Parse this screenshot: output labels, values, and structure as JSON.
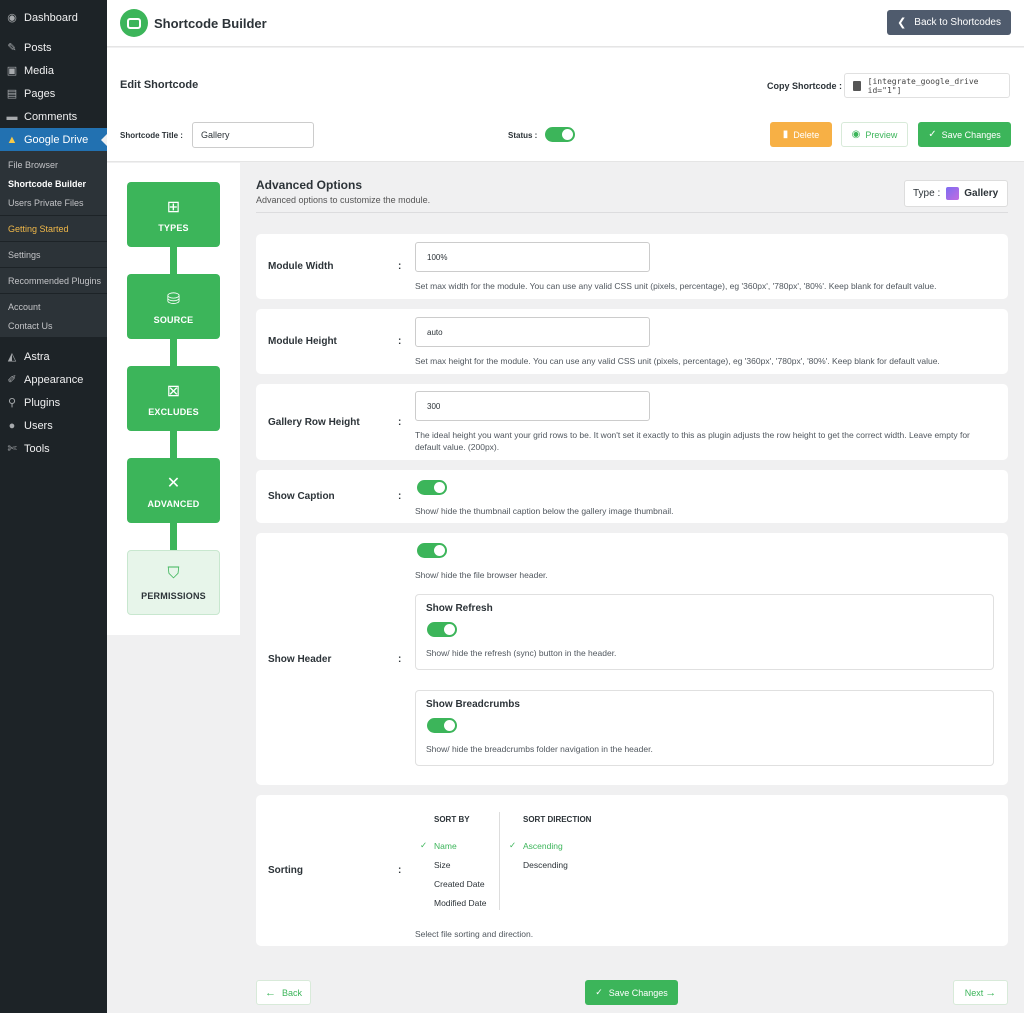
{
  "wp_menu": {
    "items_top": [
      {
        "label": "Dashboard",
        "icon": "dashboard-icon",
        "glyph": "◉"
      },
      {
        "label": "Posts",
        "icon": "pin-icon",
        "glyph": "✎"
      },
      {
        "label": "Media",
        "icon": "media-icon",
        "glyph": "▣"
      },
      {
        "label": "Pages",
        "icon": "pages-icon",
        "glyph": "▤"
      },
      {
        "label": "Comments",
        "icon": "comments-icon",
        "glyph": "▬"
      }
    ],
    "active_item": {
      "label": "Google Drive",
      "icon": "google-drive-icon",
      "glyph": "▲"
    },
    "submenu": [
      "File Browser",
      "Shortcode Builder",
      "Users Private Files",
      "Getting Started",
      "Settings",
      "Recommended Plugins",
      "Account",
      "Contact Us"
    ],
    "items_bottom": [
      {
        "label": "Astra",
        "icon": "astra-icon",
        "glyph": "◭"
      },
      {
        "label": "Appearance",
        "icon": "appearance-icon",
        "glyph": "✐"
      },
      {
        "label": "Plugins",
        "icon": "plugins-icon",
        "glyph": "⚲"
      },
      {
        "label": "Users",
        "icon": "users-icon",
        "glyph": "●"
      },
      {
        "label": "Tools",
        "icon": "tools-icon",
        "glyph": "✄"
      }
    ]
  },
  "header": {
    "brand": "Shortcode Builder",
    "back_label": "Back to Shortcodes"
  },
  "editbar": {
    "title": "Edit Shortcode",
    "copy_label": "Copy Shortcode :",
    "shortcode": "[integrate_google_drive id=\"1\"]",
    "title_label": "Shortcode Title :",
    "title_value": "Gallery",
    "status_label": "Status :",
    "delete_label": "Delete",
    "preview_label": "Preview",
    "save_label": "Save Changes"
  },
  "steps": [
    "TYPES",
    "SOURCE",
    "EXCLUDES",
    "ADVANCED",
    "PERMISSIONS"
  ],
  "section": {
    "title": "Advanced Options",
    "subtitle": "Advanced options to customize the module.",
    "type_label": "Type :",
    "type_value": "Gallery"
  },
  "options": {
    "module_width": {
      "label": "Module Width",
      "value": "100%",
      "desc": "Set max width for the module. You can use any valid CSS unit (pixels, percentage), eg '360px', '780px', '80%'. Keep blank for default value."
    },
    "module_height": {
      "label": "Module Height",
      "value": "auto",
      "desc": "Set max height for the module. You can use any valid CSS unit (pixels, percentage), eg '360px', '780px', '80%'. Keep blank for default value."
    },
    "row_height": {
      "label": "Gallery Row Height",
      "value": "300",
      "desc": "The ideal height you want your grid rows to be. It won't set it exactly to this as plugin adjusts the row height to get the correct width. Leave empty for default value. (200px)."
    },
    "show_caption": {
      "label": "Show Caption",
      "desc": "Show/ hide the thumbnail caption below the gallery image thumbnail."
    },
    "show_header": {
      "label": "Show Header",
      "desc": "Show/ hide the file browser header.",
      "refresh_title": "Show Refresh",
      "refresh_desc": "Show/ hide the refresh (sync) button in the header.",
      "breadcrumbs_title": "Show Breadcrumbs",
      "breadcrumbs_desc": "Show/ hide the breadcrumbs folder navigation in the header."
    },
    "sorting": {
      "label": "Sorting",
      "sort_by_heading": "SORT BY",
      "sort_by": [
        "Name",
        "Size",
        "Created Date",
        "Modified Date"
      ],
      "direction_heading": "SORT DIRECTION",
      "directions": [
        "Ascending",
        "Descending"
      ],
      "desc": "Select file sorting and direction."
    }
  },
  "footer": {
    "back_label": "Back",
    "save_label": "Save Changes",
    "next_label": "Next"
  },
  "colors": {
    "accent": "#3cb55a",
    "delete": "#f7b045",
    "wp_sidebar": "#1d2327",
    "wp_active": "#2271b1"
  }
}
